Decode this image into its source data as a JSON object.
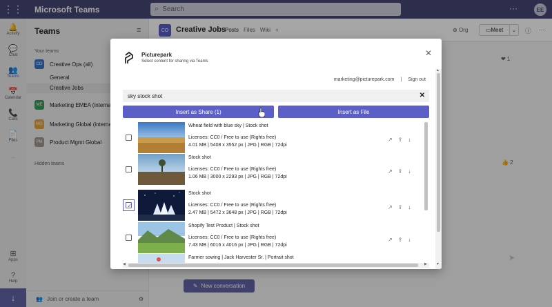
{
  "app": {
    "title": "Microsoft Teams",
    "search_placeholder": "Search",
    "avatar_initials": "EE"
  },
  "rail": {
    "items": [
      {
        "label": "Activity",
        "glyph": "🔔"
      },
      {
        "label": "Chat",
        "glyph": "💬"
      },
      {
        "label": "Teams",
        "glyph": "👥"
      },
      {
        "label": "Calendar",
        "glyph": "📅"
      },
      {
        "label": "Calls",
        "glyph": "📞"
      },
      {
        "label": "Files",
        "glyph": "📄"
      }
    ],
    "more": "···",
    "bottom": [
      {
        "label": "Apps",
        "glyph": "⊞"
      },
      {
        "label": "Help",
        "glyph": "?"
      }
    ],
    "download_glyph": "↓"
  },
  "sidebar": {
    "title": "Teams",
    "your_teams_label": "Your teams",
    "teams": [
      {
        "initials": "CO",
        "name": "Creative Ops (all)",
        "color": "#3b73c4"
      },
      {
        "initials": "ME",
        "name": "Marketing EMEA (internal)",
        "color": "#3d9b5b"
      },
      {
        "initials": "MG",
        "name": "Marketing Global (internal)",
        "color": "#e8a33a"
      },
      {
        "initials": "PM",
        "name": "Product Mgmt Global",
        "color": "#a09a8e"
      }
    ],
    "channels": [
      "General",
      "Creative Jobs"
    ],
    "hidden_teams_label": "Hidden teams",
    "join_label": "Join or create a team"
  },
  "channel": {
    "initials": "CO",
    "name": "Creative Jobs",
    "tabs": [
      "Posts",
      "Files",
      "Wiki"
    ],
    "org_label": "Org",
    "meet_label": "Meet",
    "new_conversation": "New conversation",
    "reaction_1": "❤ 1",
    "reaction_2": "👍 2"
  },
  "dialog": {
    "brand": "Picturepark",
    "subtitle": "Select content for sharing via Teams",
    "user_email": "marketing@picturepark.com",
    "separator": "|",
    "sign_out": "Sign out",
    "query": "sky stock shot",
    "clear_glyph": "✕",
    "insert_share": "Insert as Share (1)",
    "insert_file": "Insert as File",
    "results": [
      {
        "title": "Wheat field with blue sky | Stock shot",
        "license": "Licenses: CC0 / Free to use (Rights free)",
        "meta": "4.01 MB | 5408 x 3552 px | JPG | RGB | 72dpi",
        "checked": false
      },
      {
        "title": "Stock shot",
        "license": "Licenses: CC0 / Free to use (Rights free)",
        "meta": "1.06 MB | 3000 x 2293 px | JPG | RGB | 72dpi",
        "checked": false
      },
      {
        "title": "Stock shot",
        "license": "Licenses: CC0 / Free to use (Rights free)",
        "meta": "2.47 MB | 5472 x 3648 px | JPG | RGB | 72dpi",
        "checked": true
      },
      {
        "title": "Shopify Test Product | Stock shot",
        "license": "Licenses: CC0 / Free to use (Rights free)",
        "meta": "7.43 MB | 6016 x 4016 px | JPG | RGB | 72dpi",
        "checked": false
      },
      {
        "title": "Farmer sowing | Jack Harvester Sr. | Portrait shot",
        "license": "",
        "meta": "",
        "checked": false
      }
    ],
    "row_icons": [
      "↗",
      "⇪",
      "↓"
    ]
  }
}
